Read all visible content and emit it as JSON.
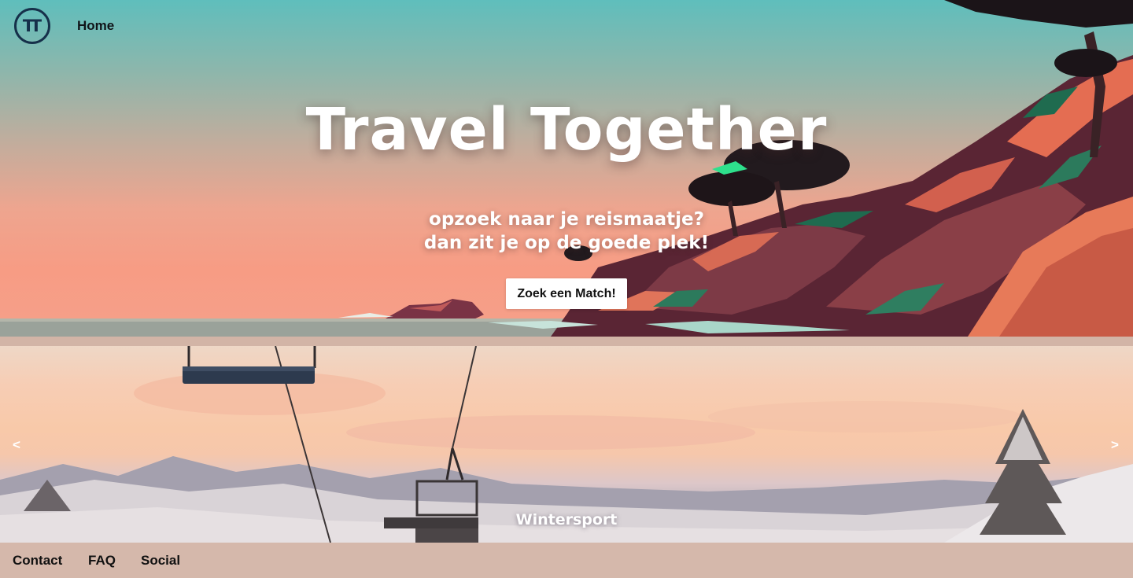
{
  "header": {
    "logo_text": "TT",
    "logo_icon": "tt-logo-icon",
    "nav_home": "Home"
  },
  "hero": {
    "title": "Travel Together",
    "subtitle_line1": "opzoek naar je reismaatje?",
    "subtitle_line2": "dan zit je op de goede plek!",
    "cta_label": "Zoek een Match!"
  },
  "carousel": {
    "prev_label": "<",
    "next_label": ">",
    "caption": "Wintersport"
  },
  "footer": {
    "links": [
      "Contact",
      "FAQ",
      "Social"
    ]
  },
  "colors": {
    "sky_top": "#5fbebc",
    "sky_bottom": "#f79c84",
    "footer_bg": "#d5b8ab",
    "logo": "#16304a",
    "cta_bg": "#ffffff"
  }
}
